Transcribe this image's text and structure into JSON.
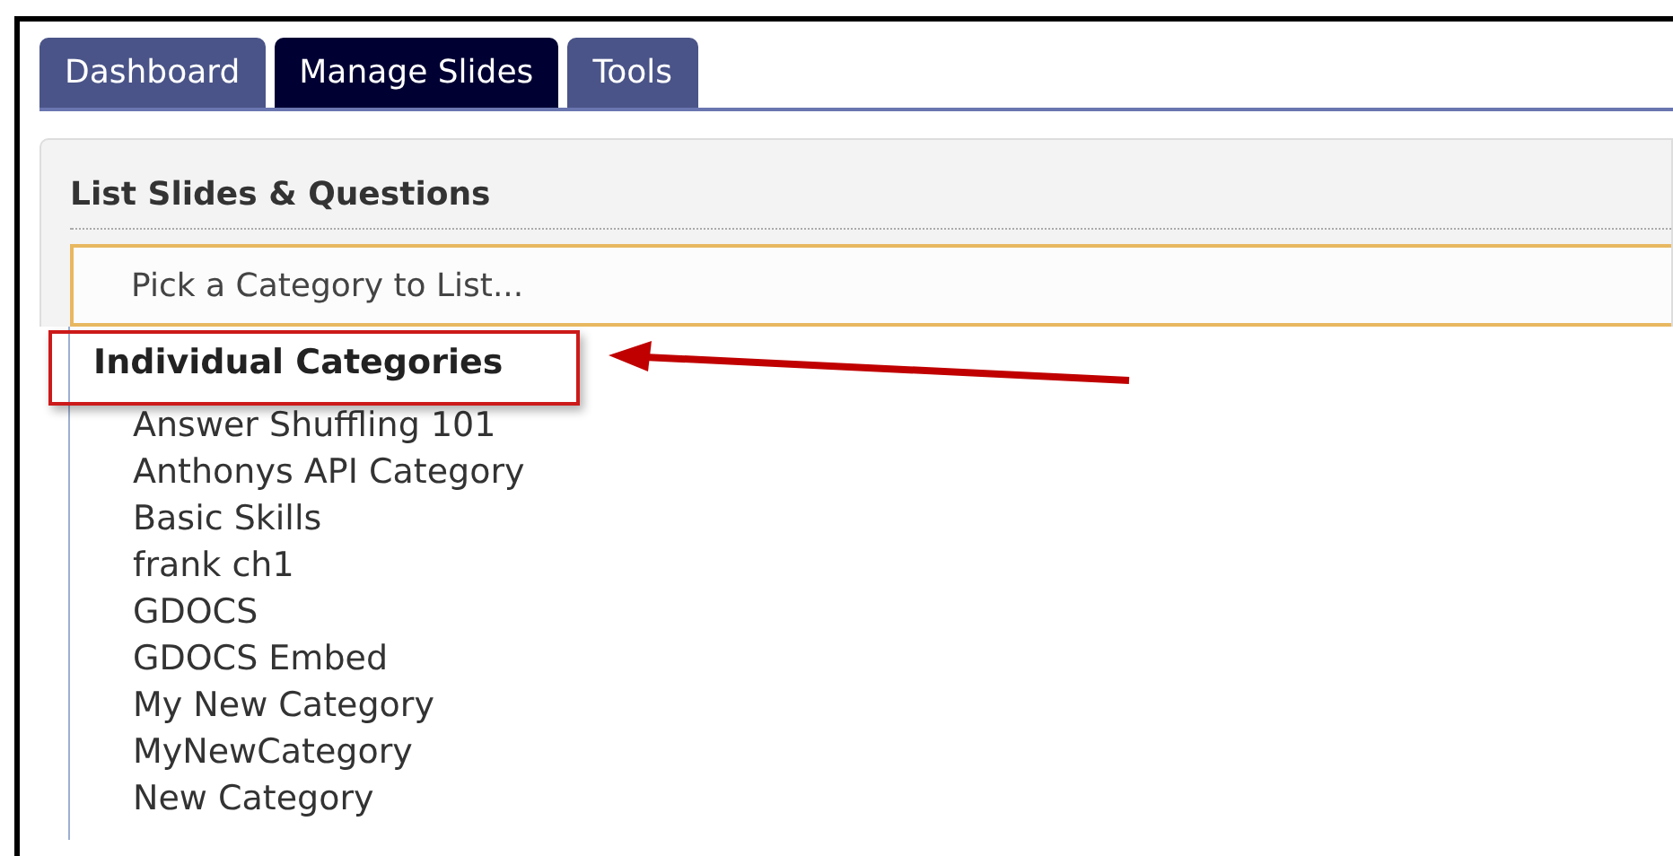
{
  "tabs": [
    {
      "label": "Dashboard",
      "selected": false
    },
    {
      "label": "Manage Slides",
      "selected": true
    },
    {
      "label": "Tools",
      "selected": false
    }
  ],
  "panel": {
    "title": "List Slides & Questions",
    "select": {
      "placeholder": "Pick a Category to List..."
    },
    "group": {
      "label": "Individual Categories",
      "highlighted": true
    },
    "items": [
      "Answer Shuffling 101",
      "Anthonys API Category",
      "Basic Skills",
      "frank ch1",
      "GDOCS",
      "GDOCS Embed",
      "My New Category",
      "MyNewCategory",
      "New Category"
    ]
  }
}
